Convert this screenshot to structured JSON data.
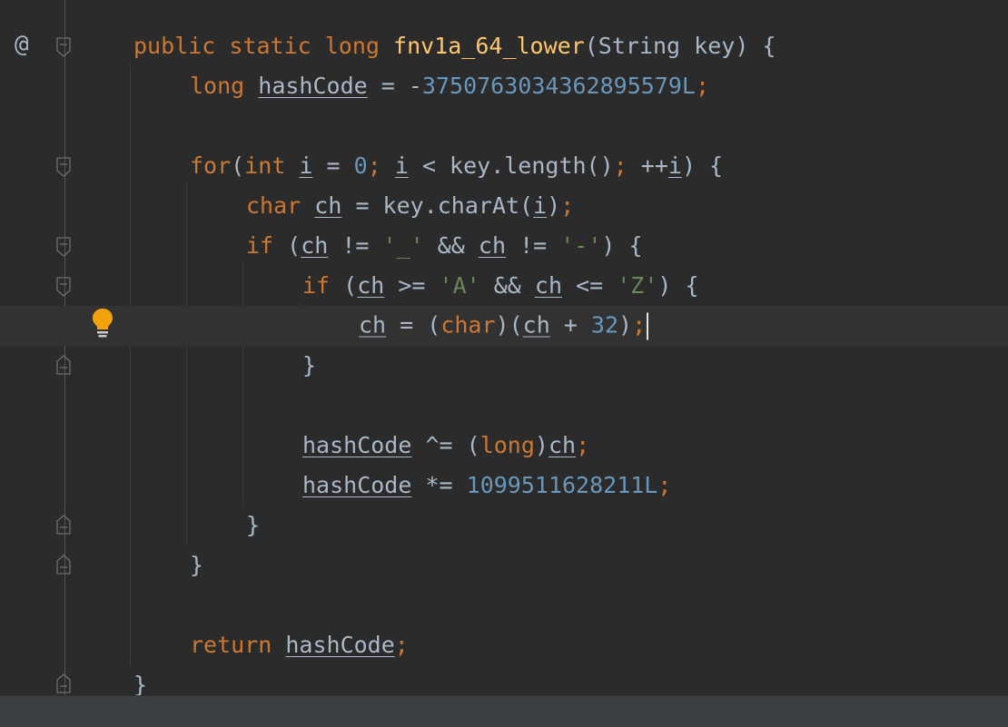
{
  "gutter": {
    "annotation_symbol": "@"
  },
  "code": {
    "l1_public": "public",
    "l1_static": "static",
    "l1_long": "long",
    "l1_method": "fnv1a_64_lower",
    "l1_params": "(String key) {",
    "l2_long": "long",
    "l2_var": "hashCode",
    "l2_eq": " = -",
    "l2_num": "3750763034362895579L",
    "l2_semi": ";",
    "l4_for": "for",
    "l4_paren": "(",
    "l4_int": "int",
    "l4_i1": "i",
    "l4_eq": " = ",
    "l4_zero": "0",
    "l4_semi1": "; ",
    "l4_i2": "i",
    "l4_cond": " < key.length()",
    "l4_semi2": "; ",
    "l4_inc": "++",
    "l4_i3": "i",
    "l4_close": ") {",
    "l5_char": "char",
    "l5_ch": "ch",
    "l5_mid": " = key.charAt(",
    "l5_i": "i",
    "l5_close": ")",
    "l5_semi": ";",
    "l6_if": "if",
    "l6_open": " (",
    "l6_ch1": "ch",
    "l6_ne1": " != ",
    "l6_str1": "'_'",
    "l6_and": " && ",
    "l6_ch2": "ch",
    "l6_ne2": " != ",
    "l6_str2": "'-'",
    "l6_close": ") {",
    "l7_if": "if",
    "l7_open": " (",
    "l7_ch1": "ch",
    "l7_ge": " >= ",
    "l7_str1": "'A'",
    "l7_and": " && ",
    "l7_ch2": "ch",
    "l7_le": " <= ",
    "l7_str2": "'Z'",
    "l7_close": ") {",
    "l8_ch1": "ch",
    "l8_eq": " = (",
    "l8_char": "char",
    "l8_mid": ")(",
    "l8_ch2": "ch",
    "l8_plus": " + ",
    "l8_num": "32",
    "l8_close": ")",
    "l8_semi": ";",
    "l9_brace": "}",
    "l11_var": "hashCode",
    "l11_op": " ^= (",
    "l11_long": "long",
    "l11_close": ")",
    "l11_ch": "ch",
    "l11_semi": ";",
    "l12_var": "hashCode",
    "l12_op": " *= ",
    "l12_num": "1099511628211L",
    "l12_semi": ";",
    "l13_brace": "}",
    "l14_brace": "}",
    "l16_return": "return",
    "l16_var": "hashCode",
    "l16_semi": ";",
    "l17_brace": "}"
  },
  "colors": {
    "background": "#2b2b2b",
    "keyword": "#cc7832",
    "method": "#ffc66d",
    "number": "#6897bb",
    "string": "#6a8759",
    "text": "#a9b7c6",
    "bulb": "#f0a30a"
  },
  "icons": [
    "annotation-at-icon",
    "fold-start-icon",
    "fold-end-icon",
    "intention-bulb-icon"
  ]
}
